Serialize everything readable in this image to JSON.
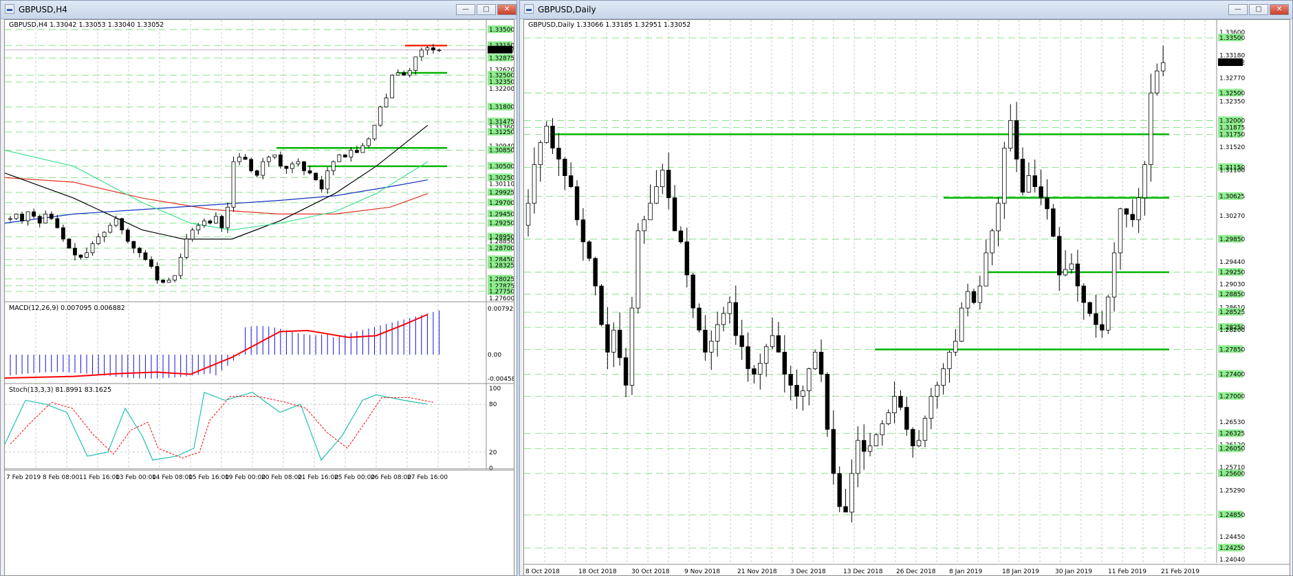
{
  "left_window": {
    "title": "GBPUSD,H4",
    "header": "GBPUSD,H4  1.33042 1.33053 1.33040 1.33052",
    "price_labels": [
      "1.33500",
      "1.33150",
      "1.33052",
      "1.32875",
      "1.32620",
      "1.32500",
      "1.32350",
      "1.32200",
      "1.31800",
      "1.31475",
      "1.31360",
      "1.31250",
      "1.30940",
      "1.30850",
      "1.30500",
      "1.30250",
      "1.30110",
      "1.29925",
      "1.29700",
      "1.29450",
      "1.29250",
      "1.28950",
      "1.28850",
      "1.28700",
      "1.28450",
      "1.28325",
      "1.28025",
      "1.27875",
      "1.27750",
      "1.27600"
    ],
    "current_price": "1.33052",
    "macd": {
      "label": "MACD(12,26,9) 0.007095 0.006882",
      "axis": [
        "0.007926",
        "0.00",
        "-0.004584"
      ]
    },
    "stoch": {
      "label": "Stoch(13,3,3) 81.8991 83.1625",
      "axis": [
        "100",
        "80",
        "20",
        "0"
      ]
    },
    "time_labels": [
      "7 Feb 2019",
      "8 Feb 08:00",
      "11 Feb 16:00",
      "13 Feb 00:00",
      "14 Feb 08:00",
      "15 Feb 16:00",
      "19 Feb 00:00",
      "20 Feb 08:00",
      "21 Feb 16:00",
      "25 Feb 00:00",
      "26 Feb 08:00",
      "27 Feb 16:00"
    ]
  },
  "right_window": {
    "title": "GBPUSD,Daily",
    "header": "GBPUSD,Daily  1.33066 1.33185 1.32951 1.33052",
    "price_labels": [
      "1.33600",
      "1.33500",
      "1.33180",
      "1.33052",
      "1.32770",
      "1.32500",
      "1.32350",
      "1.32000",
      "1.31875",
      "1.31520",
      "1.31750",
      "1.31150",
      "1.31100",
      "1.30625",
      "1.30270",
      "1.29850",
      "1.29440",
      "1.29250",
      "1.29030",
      "1.28850",
      "1.28610",
      "1.28525",
      "1.28250",
      "1.28200",
      "1.27850",
      "1.27400",
      "1.27000",
      "1.26530",
      "1.26325",
      "1.26120",
      "1.26050",
      "1.25710",
      "1.25600",
      "1.25290",
      "1.24850",
      "1.24450",
      "1.24250",
      "1.24040"
    ],
    "current_price": "1.33052",
    "time_labels": [
      "8 Oct 2018",
      "18 Oct 2018",
      "30 Oct 2018",
      "9 Nov 2018",
      "21 Nov 2018",
      "3 Dec 2018",
      "13 Dec 2018",
      "26 Dec 2018",
      "8 Jan 2019",
      "18 Jan 2019",
      "30 Jan 2019",
      "11 Feb 2019",
      "21 Feb 2019"
    ]
  },
  "colors": {
    "grid": "#a9a9a9",
    "support": "#00b400",
    "resistance": "#ff2a00",
    "macd_hist": "#1010dd",
    "signal": "#ff0000",
    "stoch_main": "#20c0b0",
    "stoch_signal": "#ff0000",
    "ma_red": "#e03020",
    "ma_blue": "#1030c0",
    "ma_black": "#000000",
    "ma_green": "#40e090",
    "label_bg": "#90ee90"
  },
  "window_buttons": {
    "minimize": "—",
    "maximize": "□",
    "close": "✕"
  }
}
